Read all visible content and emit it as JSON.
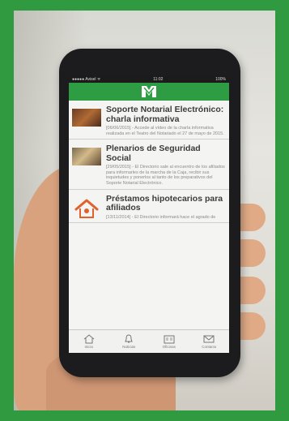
{
  "status_bar": {
    "carrier": "●●●●● Avisel  ᯤ",
    "time": "11:02",
    "battery": "100%"
  },
  "app_logo": "app-logo-icon",
  "news": [
    {
      "title": "Soporte Notarial Electrónico: charla informativa",
      "text": "[06/06/2015] - Accede al vídeo de la charla informativa realizada en el Teatro del Notariado el 27 de mayo de 2015."
    },
    {
      "title": "Plenarios de Seguridad Social",
      "text": "[29/05/2015] - El Directorio sale al encuentro de los afiliados para informarles de la marcha de la Caja, recibir sus inquietudes y ponerlos al tanto de los preparativos del Soporte Notarial Electrónico."
    },
    {
      "title": "Préstamos hipotecarios para afiliados",
      "text": "[13/11/2014] - El Directorio informará hace el agrado de"
    }
  ],
  "tabs": [
    {
      "label": "Inicio",
      "icon": "home-icon"
    },
    {
      "label": "Noticias",
      "icon": "bell-icon"
    },
    {
      "label": "Oficinas",
      "icon": "office-icon"
    },
    {
      "label": "Contacto",
      "icon": "mail-icon"
    }
  ],
  "colors": {
    "brand_green": "#2d9c43",
    "frame_green": "#2f9a3f",
    "title_gray": "#3b3b3b"
  }
}
